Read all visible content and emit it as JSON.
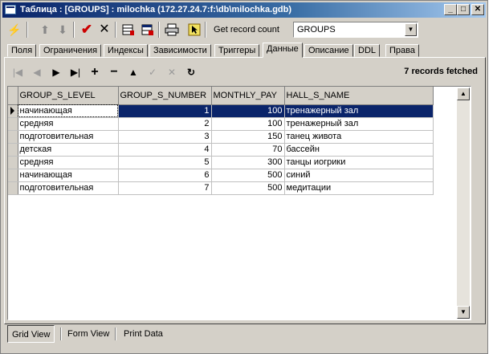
{
  "window": {
    "title": "Таблица : [GROUPS] : milochka (172.27.24.7:f:\\db\\milochka.gdb)",
    "buttons": {
      "minimize": "_",
      "maximize": "□",
      "close": "✕"
    }
  },
  "toolbar": {
    "get_record_count": "Get record count",
    "table_selector": "GROUPS",
    "icons": [
      "lightning-icon",
      "arrow-up-icon",
      "arrow-down-icon",
      "commit-check-icon",
      "rollback-x-icon",
      "grid-export-icon",
      "grid-calendar-icon",
      "print-icon",
      "cursor-icon"
    ]
  },
  "tabs": [
    "Поля",
    "Ограничения",
    "Индексы",
    "Зависимости",
    "Триггеры",
    "Данные",
    "Описание",
    "DDL",
    "Права"
  ],
  "active_tab": "Данные",
  "navigator": {
    "status": "7 records fetched",
    "buttons": [
      "first",
      "prior",
      "next",
      "last",
      "insert",
      "delete",
      "edit",
      "post",
      "cancel",
      "refresh"
    ]
  },
  "grid": {
    "columns": [
      "GROUP_S_LEVEL",
      "GROUP_S_NUMBER",
      "MONTHLY_PAY",
      "HALL_S_NAME"
    ],
    "rows": [
      [
        "начинающая",
        "1",
        "100",
        "тренажерный зал"
      ],
      [
        "средняя",
        "2",
        "100",
        "тренажерный зал"
      ],
      [
        "подготовительная",
        "3",
        "150",
        "танец живота"
      ],
      [
        "детская",
        "4",
        "70",
        "бассейн"
      ],
      [
        "средняя",
        "5",
        "300",
        "танцы иогрики"
      ],
      [
        "начинающая",
        "6",
        "500",
        "синий"
      ],
      [
        "подготовительная",
        "7",
        "500",
        "медитации"
      ]
    ],
    "selected_row": 0
  },
  "view_tabs": [
    "Grid View",
    "Form View",
    "Print Data"
  ],
  "active_view": "Grid View",
  "colors": {
    "titlebar": "#0a246a",
    "selection": "#0a246a",
    "face": "#d4d0c8",
    "commit": "#cc0000"
  }
}
